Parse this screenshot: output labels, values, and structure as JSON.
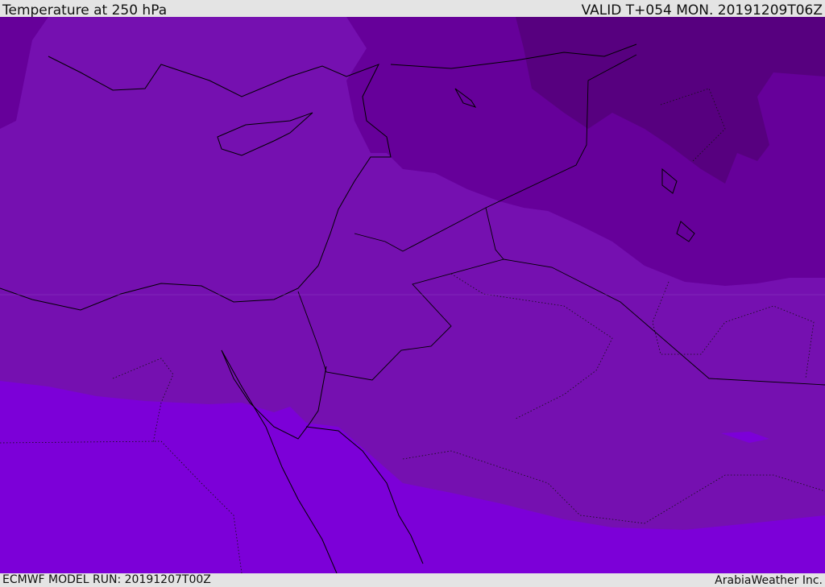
{
  "header": {
    "title": "Temperature at 250 hPa",
    "valid": "VALID T+054 MON. 20191209T06Z"
  },
  "footer": {
    "model_run": "ECMWF MODEL RUN: 20191207T00Z",
    "credit": "ArabiaWeather Inc."
  },
  "colors": {
    "darkest": "#57007f",
    "dark": "#66009a",
    "mid": "#7510b0",
    "bright": "#7c00d8",
    "background": "#e4e4e4"
  }
}
